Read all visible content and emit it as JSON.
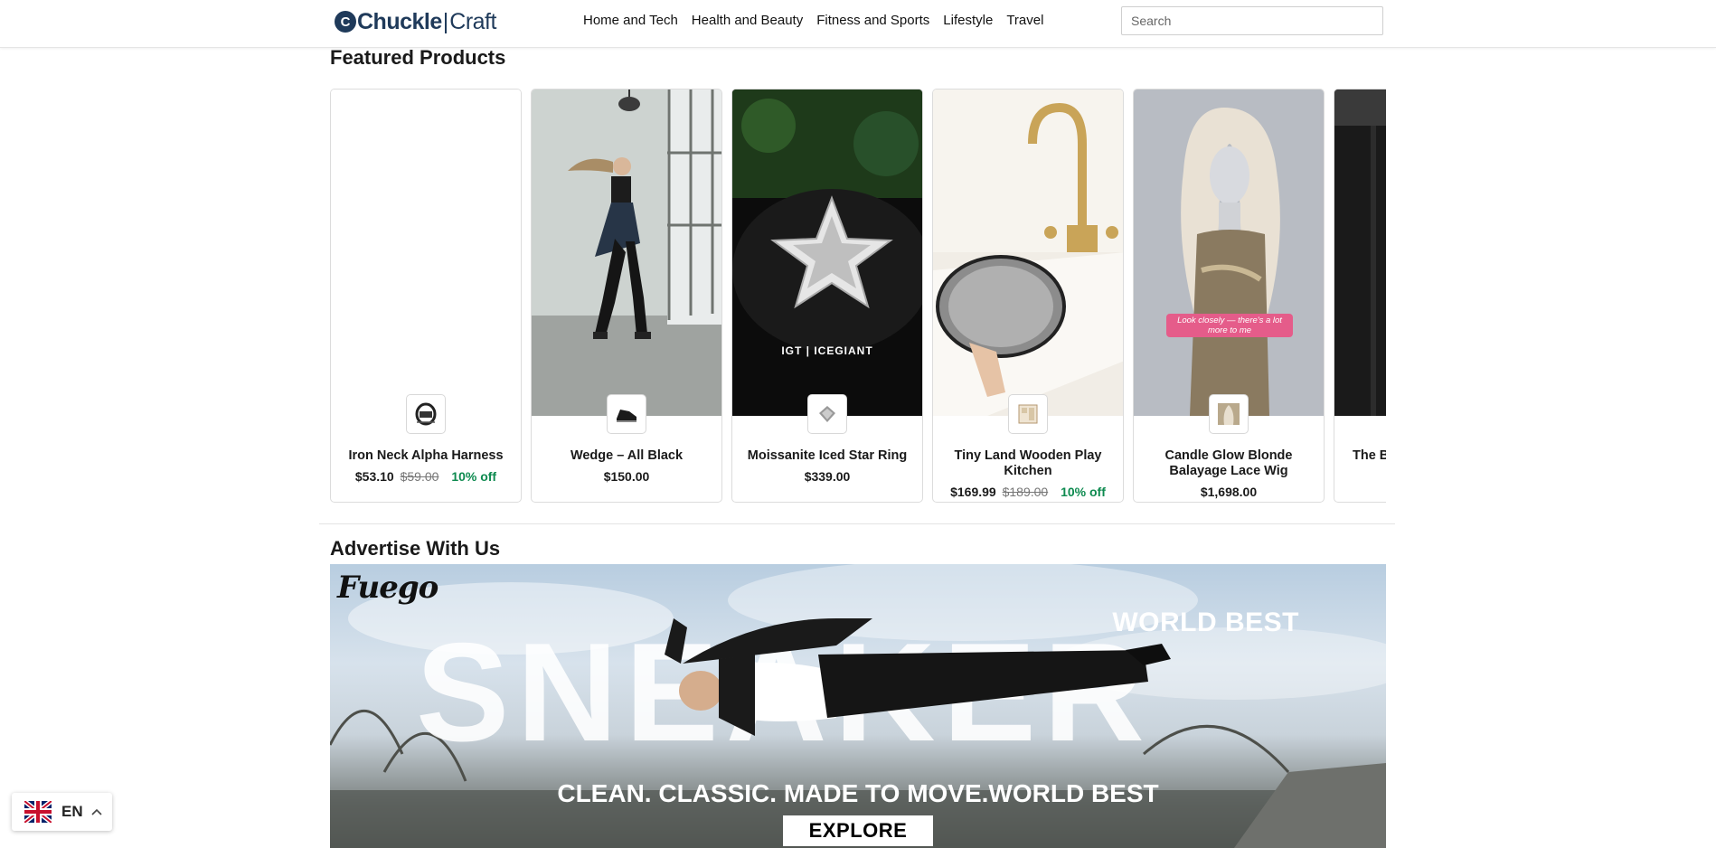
{
  "header": {
    "logo_a": "Chuckle",
    "logo_sep": "|",
    "logo_b": "Craft",
    "nav": [
      "Home and Tech",
      "Health and Beauty",
      "Fitness and Sports",
      "Lifestyle",
      "Travel"
    ],
    "search_placeholder": "Search"
  },
  "featured": {
    "title": "Featured Products",
    "products": [
      {
        "name": "Iron Neck Alpha Harness",
        "price": "$53.10",
        "old_price": "$59.00",
        "discount": "10% off"
      },
      {
        "name": "Wedge – All Black",
        "price": "$150.00",
        "old_price": "",
        "discount": ""
      },
      {
        "name": "Moissanite Iced Star Ring",
        "price": "$339.00",
        "old_price": "",
        "discount": "",
        "media_text": "IGT | ICEGIANT"
      },
      {
        "name": "Tiny Land Wooden Play Kitchen",
        "price": "$169.99",
        "old_price": "$189.00",
        "discount": "10% off"
      },
      {
        "name": "Candle Glow Blonde Balayage Lace Wig",
        "price": "$1,698.00",
        "old_price": "",
        "discount": "",
        "media_text": "Look closely — there's a lot more to me"
      },
      {
        "name": "The B",
        "price": "",
        "old_price": "",
        "discount": ""
      }
    ]
  },
  "advertise": {
    "title": "Advertise With Us",
    "brand": "Fuego",
    "headline_small": "WORLD BEST",
    "headline_big": "SNEAKER",
    "tagline": "CLEAN. CLASSIC. MADE TO MOVE.WORLD BEST",
    "cta": "EXPLORE"
  },
  "language": {
    "code": "EN"
  },
  "colors": {
    "brand": "#1f3a5a",
    "discount": "#0d8a4f",
    "wig_badge": "#e55c8a"
  }
}
